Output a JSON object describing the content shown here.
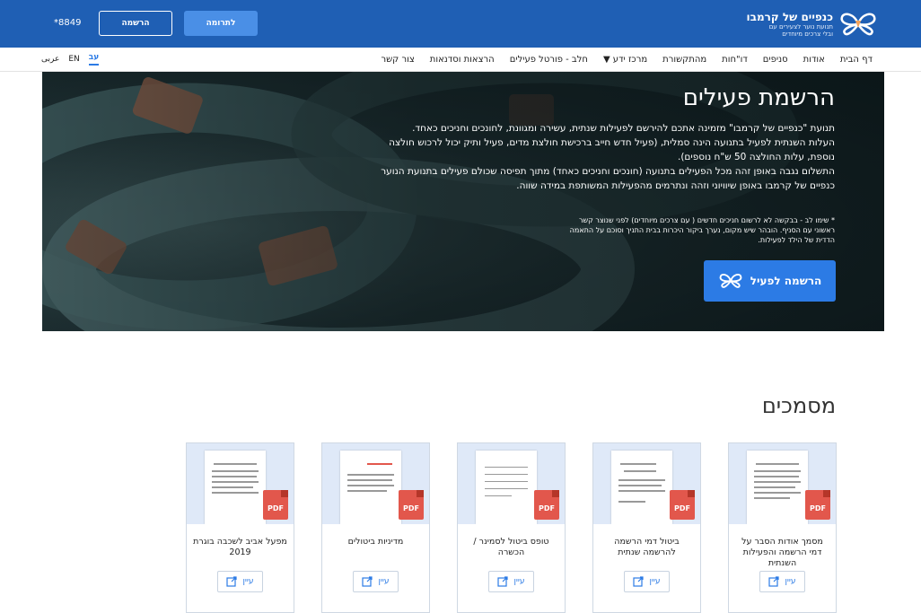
{
  "header": {
    "logo_title": "כנפיים של קרמבו",
    "logo_sub1": "תנועת נוער לצעירים עם",
    "logo_sub2": "ובלי צרכים מיוחדים",
    "donate_label": "לתרומה",
    "register_label": "הרשמה",
    "phone": "*8849"
  },
  "nav": {
    "items": [
      {
        "label": "דף הבית"
      },
      {
        "label": "אודות"
      },
      {
        "label": "סניפים"
      },
      {
        "label": "דו\"חות"
      },
      {
        "label": "מהתקשורת"
      },
      {
        "label": "מרכז ידע ▼"
      },
      {
        "label": "חלב - פורטל פעילים"
      },
      {
        "label": "הרצאות וסדנאות"
      },
      {
        "label": "צור קשר"
      }
    ],
    "languages": [
      {
        "label": "עב",
        "active": true
      },
      {
        "label": "EN"
      },
      {
        "label": "عربى"
      }
    ]
  },
  "hero": {
    "title": "הרשמת פעילים",
    "paragraph1": "תנועת \"כנפיים של קרמבו\" מזמינה אתכם להירשם לפעילות שנתית, עשירה ומגוונת, לחונכים וחניכים כאחד.",
    "paragraph2": "העלות השנתית לפעיל בתנועה הינה סמלית, (פעיל חדש חייב ברכישת חולצת מדים, פעיל ותיק יכול לרכוש חולצה נוספת, עלות החולצה 50 ש\"ח נוספים).",
    "paragraph3": "התשלום נגבה באופן זהה מכל הפעילים בתנועה (חונכים וחניכים כאחד) מתוך תפיסה שכולם פעילים בתנועת הנוער כנפיים של קרמבו באופן שיוויוני וזהה ונתרמים מהפעילות המשותפת במידה שווה.",
    "note": "* שימו לב - בבקשה לא לרשום חניכים חדשים ( עם צרכים מיוחדים) לפני שנוצר קשר ראשוני עם הסניף. הובהר שיש מקום, נערך ביקור היכרות בבית התניך וסוכם על התאמה הדדית של הילד לפעילות.",
    "button_label": "הרשמה לפעיל"
  },
  "documents": {
    "title": "מסמכים",
    "view_label": "עיין",
    "pdf_label": "PDF",
    "cards": [
      {
        "title": "מסמך אודות הסבר על דמי הרשמה והפעילות השנתית"
      },
      {
        "title": "ביטול דמי הרשמה להרשמה שנתית"
      },
      {
        "title": "טופס ביטול לסמינר / הכשרה"
      },
      {
        "title": "מדיניות ביטולים"
      },
      {
        "title": "מפעל אביב לשכבה בוגרת 2019"
      }
    ]
  },
  "colors": {
    "brand_blue": "#1f5fb4",
    "accent_blue": "#2c7be5",
    "pdf_red": "#e2574c"
  }
}
